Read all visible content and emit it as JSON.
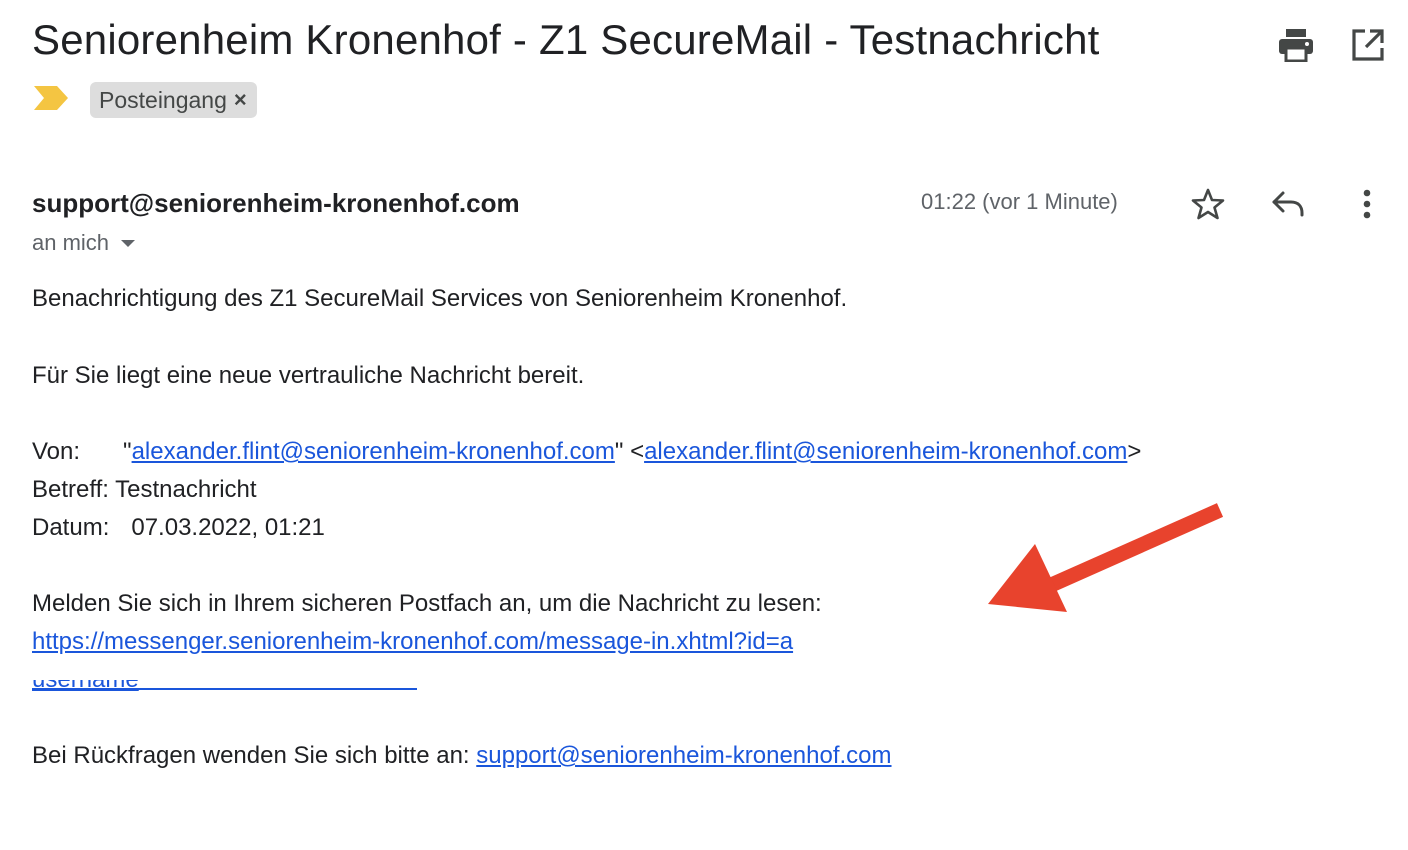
{
  "email": {
    "subject": "Seniorenheim Kronenhof - Z1 SecureMail - Testnachricht",
    "label": "Posteingang",
    "label_close": "×",
    "sender": "support@seniorenheim-kronenhof.com",
    "recipient": "an mich",
    "timestamp": "01:22 (vor 1 Minute)"
  },
  "body": {
    "line1": "Benachrichtigung des Z1 SecureMail Services von Seniorenheim Kronenhof.",
    "line2": "Für Sie liegt eine neue vertrauliche Nachricht bereit.",
    "von_label": "Von:",
    "von_quote_open": "\"",
    "von_link1": "alexander.flint@seniorenheim-kronenhof.com",
    "von_mid": "\" <",
    "von_link2": "alexander.flint@seniorenheim-kronenhof.com",
    "von_close": ">",
    "betreff": "Betreff: Testnachricht",
    "datum_label": "Datum:",
    "datum_value": "07.03.2022, 01:21",
    "melden": "Melden Sie sich in Ihrem sicheren Postfach an, um die Nachricht zu lesen:",
    "url_line1": "https://messenger.seniorenheim-kronenhof.com/message-in.xhtml?id=a",
    "url_line2": "username",
    "rueckfragen": "Bei Rückfragen wenden Sie sich bitte an:",
    "support_link": "support@seniorenheim-kronenhof.com"
  },
  "icons": {
    "print": "print-icon",
    "open_new_window": "open-in-new-window-icon",
    "label_marker": "important-marker-icon",
    "star": "star-icon",
    "reply": "reply-icon",
    "more": "more-vert-icon"
  },
  "colors": {
    "link": "#1a56db",
    "importance_marker": "#f4c542",
    "annotation_arrow": "#e8432d",
    "chip_bg": "#dddddd"
  }
}
